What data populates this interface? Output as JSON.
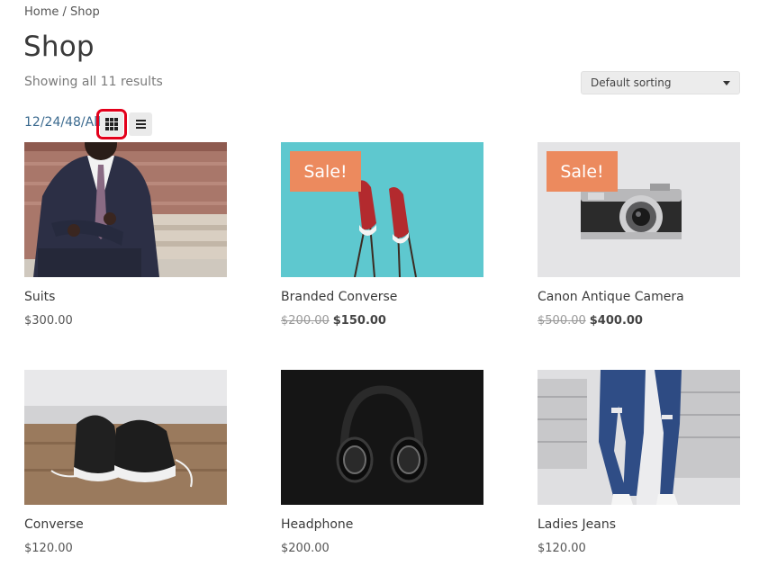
{
  "breadcrumb": {
    "home": "Home",
    "separator": " / ",
    "current": "Shop"
  },
  "page_title": "Shop",
  "result_count": "Showing all 11 results",
  "sorting": {
    "selected": "Default sorting"
  },
  "per_page": {
    "options": [
      "12",
      "24",
      "48",
      "All"
    ],
    "separator": "/"
  },
  "view_toggle": {
    "grid_icon": "grid-icon",
    "list_icon": "list-icon",
    "active": "grid"
  },
  "colors": {
    "accent_link": "#3b6a8f",
    "sale_badge": "#ec8a5e",
    "highlight": "#e3001b"
  },
  "products": [
    {
      "name": "Suits",
      "price": "$300.00",
      "regular_price": "",
      "sale": false
    },
    {
      "name": "Branded Converse",
      "price": "$150.00",
      "regular_price": "$200.00",
      "sale": true,
      "badge": "Sale!"
    },
    {
      "name": "Canon Antique Camera",
      "price": "$400.00",
      "regular_price": "$500.00",
      "sale": true,
      "badge": "Sale!"
    },
    {
      "name": "Converse",
      "price": "$120.00",
      "regular_price": "",
      "sale": false
    },
    {
      "name": "Headphone",
      "price": "$200.00",
      "regular_price": "",
      "sale": false
    },
    {
      "name": "Ladies Jeans",
      "price": "$120.00",
      "regular_price": "",
      "sale": false
    }
  ]
}
